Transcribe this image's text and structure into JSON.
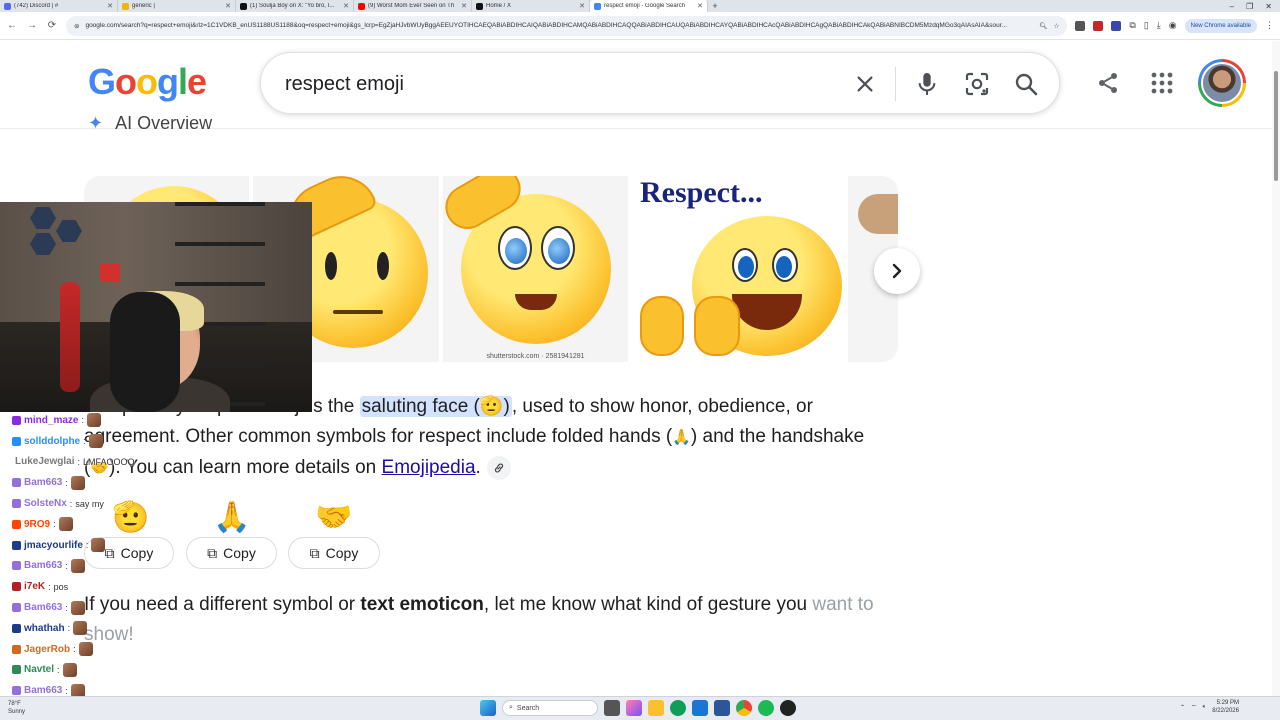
{
  "browser": {
    "tabs": [
      {
        "title": "(742) Discord | #",
        "color": "#5865f2"
      },
      {
        "title": "generic |",
        "color": "#f4b400"
      },
      {
        "title": "(1) Soulja Boy on X: \"Yo bro, I...",
        "color": "#111111"
      },
      {
        "title": "(9) Worst Mom Ever Seen on Th",
        "color": "#ff0000"
      },
      {
        "title": "Home / X",
        "color": "#111111"
      },
      {
        "title": "respect emoji - Google Search",
        "color": "#4285f4",
        "active": true
      }
    ],
    "new_tab": "+",
    "window_controls": [
      "–",
      "❐",
      "✕"
    ],
    "url": "google.com/search?q=respect+emoji&rlz=1C1VDKB_enUS1188US1188&oq=respect+emoji&gs_lcrp=EgZjaHJvbWUyBggAEEUYOTIHCAEQABiABDIHCAIQABiABDIHCAMQABiABDIHCAQQABiABDIHCAUQABiABDIHCAYQABiABDIHCAcQABiABDIHCAgQABiABDIHCAkQABiABNIBCDM5MzdqMGo3qAIAsAIA&sour...",
    "new_chrome": "New Chrome available"
  },
  "header": {
    "logo_letters": [
      "G",
      "o",
      "o",
      "g",
      "l",
      "e"
    ],
    "query": "respect emoji"
  },
  "ai_overview": {
    "heading": "AI Overview",
    "images": [
      {
        "caption": ""
      },
      {
        "caption": ""
      },
      {
        "caption": "shutterstock.com · 2581941281"
      },
      {
        "title": "Respect...",
        "caption": ""
      },
      {
        "caption": ""
      }
    ],
    "answer": {
      "p1_start": "The primary respect emoji is the ",
      "highlight": "saluting face (🫡)",
      "p1_mid": ", used to show honor, obedience, or agreement. Other common symbols for respect include folded hands (",
      "emoji_hands": "🙏",
      "p1_mid2": ") and the handshake (",
      "emoji_shake": "🤝",
      "p1_end": "). You can learn more details on ",
      "link": "Emojipedia",
      "period": "."
    },
    "emojis": [
      {
        "glyph": "🫡",
        "copy_label": "Copy"
      },
      {
        "glyph": "🙏",
        "copy_label": "Copy"
      },
      {
        "glyph": "🤝",
        "copy_label": "Copy"
      }
    ],
    "followup": {
      "start": "If you need a different symbol or ",
      "bold": "text emoticon",
      "mid": ", let me know what kind of gesture you ",
      "end": "want to show!"
    }
  },
  "chat": [
    {
      "user": "mind_maze",
      "msg": "",
      "color": "#8a2be2"
    },
    {
      "user": "sollddolphe",
      "msg": "",
      "color": "#1e90ff"
    },
    {
      "user": "LukeJewglai",
      "msg": "LMFAOOOO",
      "color": "#7a7a7a"
    },
    {
      "user": "Bam663",
      "msg": "",
      "color": "#9370db"
    },
    {
      "user": "SolsteNx",
      "msg": "say my",
      "color": "#9370db"
    },
    {
      "user": "9RO9",
      "msg": "",
      "color": "#ff4500"
    },
    {
      "user": "jmacyourlife",
      "msg": "",
      "color": "#1e3a8a"
    },
    {
      "user": "Bam663",
      "msg": "",
      "color": "#9370db"
    },
    {
      "user": "i7eK",
      "msg": "pos",
      "color": "#b22222"
    },
    {
      "user": "Bam663",
      "msg": "",
      "color": "#9370db"
    },
    {
      "user": "whathah",
      "msg": "",
      "color": "#1e3a8a"
    },
    {
      "user": "JagerRob",
      "msg": "",
      "color": "#d2691e"
    },
    {
      "user": "Navtel",
      "msg": "",
      "color": "#2e8b57"
    },
    {
      "user": "Bam663",
      "msg": "",
      "color": "#9370db"
    }
  ],
  "taskbar": {
    "weather_temp": "78°F",
    "weather_desc": "Sunny",
    "search_label": "Search",
    "time": "5:29 PM",
    "date": "8/22/2026"
  }
}
